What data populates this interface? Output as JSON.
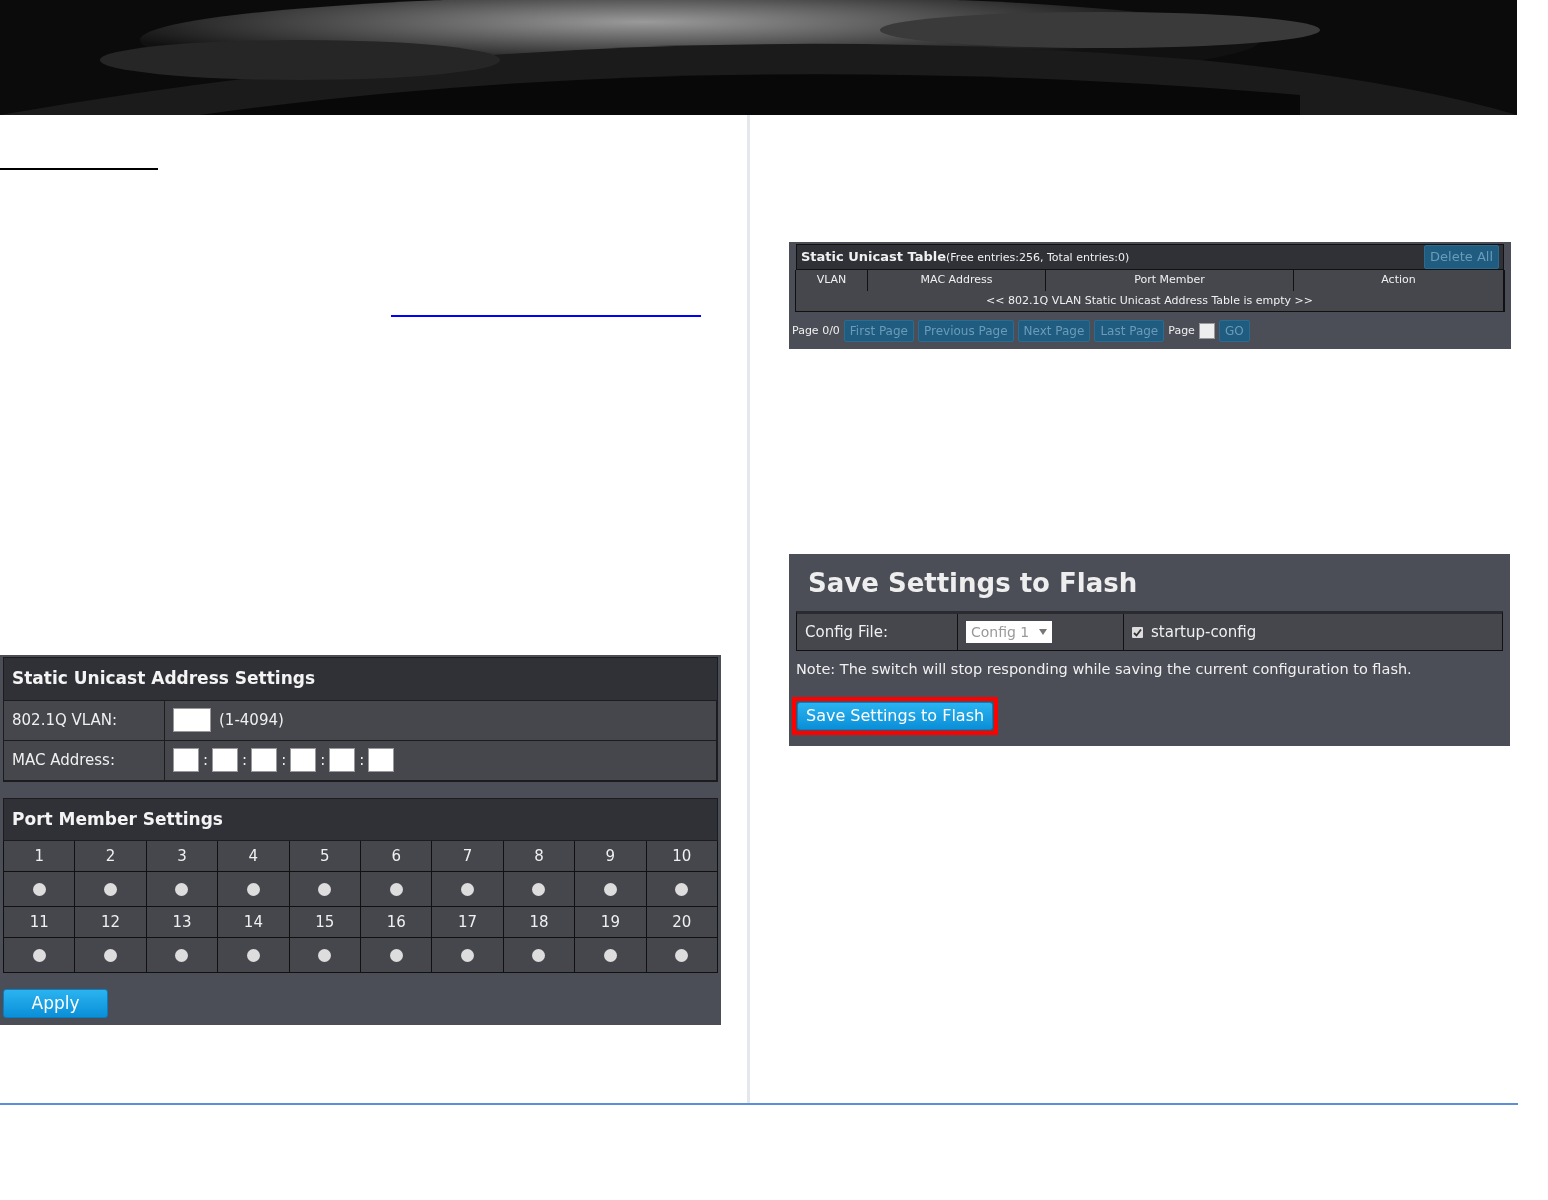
{
  "settings_panel": {
    "title": "Static Unicast Address Settings",
    "fields": [
      {
        "kind": "vlan",
        "label": "802.1Q VLAN:",
        "hint": "(1-4094)"
      },
      {
        "kind": "mac",
        "label": "MAC Address:",
        "separators": [
          ":",
          ":",
          ":",
          ":",
          ":"
        ]
      }
    ]
  },
  "port_panel": {
    "title": "Port Member Settings",
    "ports": [
      {
        "label": "1",
        "selected": false
      },
      {
        "label": "2",
        "selected": false
      },
      {
        "label": "3",
        "selected": false
      },
      {
        "label": "4",
        "selected": false
      },
      {
        "label": "5",
        "selected": false
      },
      {
        "label": "6",
        "selected": false
      },
      {
        "label": "7",
        "selected": false
      },
      {
        "label": "8",
        "selected": false
      },
      {
        "label": "9",
        "selected": false
      },
      {
        "label": "10",
        "selected": false
      },
      {
        "label": "11",
        "selected": false
      },
      {
        "label": "12",
        "selected": false
      },
      {
        "label": "13",
        "selected": false
      },
      {
        "label": "14",
        "selected": false
      },
      {
        "label": "15",
        "selected": false
      },
      {
        "label": "16",
        "selected": false
      },
      {
        "label": "17",
        "selected": false
      },
      {
        "label": "18",
        "selected": false
      },
      {
        "label": "19",
        "selected": false
      },
      {
        "label": "20",
        "selected": false
      }
    ],
    "apply_button": "Apply"
  },
  "unicast_table": {
    "title": "Static Unicast Table",
    "subtitle": "(Free entries:256, Total entries:0)",
    "delete_button": {
      "label": "Delete All",
      "disabled": true
    },
    "columns": [
      "VLAN",
      "MAC Address",
      "Port Member",
      "Action"
    ],
    "empty_message": "<< 802.1Q VLAN Static Unicast Address Table is empty >>",
    "pager": {
      "page_label": "Page 0/0",
      "buttons": [
        {
          "label": "First Page",
          "disabled": true
        },
        {
          "label": "Previous Page",
          "disabled": true
        },
        {
          "label": "Next Page",
          "disabled": true
        },
        {
          "label": "Last Page",
          "disabled": true
        }
      ],
      "goto_label": "Page",
      "go_button": {
        "label": "GO",
        "disabled": true
      }
    }
  },
  "save_panel": {
    "title": "Save Settings to Flash",
    "config_label": "Config File:",
    "config_value": "Config 1",
    "checkbox": {
      "label": "startup-config",
      "checked": true
    },
    "note": "Note: The switch will stop responding while saving the current configuration to flash.",
    "save_button": {
      "label": "Save Settings to Flash",
      "highlighted": true
    }
  }
}
